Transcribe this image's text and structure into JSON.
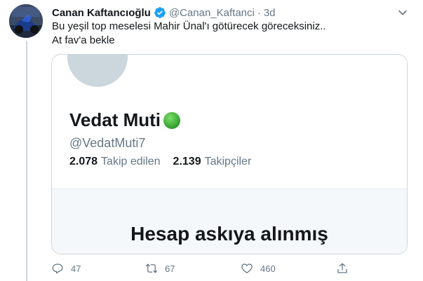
{
  "tweet": {
    "author_name": "Canan Kaftancıoğlu",
    "author_handle": "@Canan_Kaftanci",
    "separator": "·",
    "time": "3d",
    "text_line1": "Bu yeşil top meselesi Mahir Ünal'ı götürecek göreceksiniz..",
    "text_line2": "At fav'a bekle"
  },
  "card": {
    "name": "Vedat Muti",
    "handle": "@VedatMuti7",
    "following_count": "2.078",
    "following_label": "Takip edilen",
    "followers_count": "2.139",
    "followers_label": "Takipçiler",
    "suspended_text": "Hesap askıya alınmış"
  },
  "actions": {
    "replies": "47",
    "retweets": "67",
    "likes": "460"
  },
  "icons": {
    "verified": "verified-badge-icon",
    "caret": "chevron-down-icon",
    "reply": "reply-icon",
    "retweet": "retweet-icon",
    "like": "heart-icon",
    "share": "share-icon",
    "status": "green-circle-emoji"
  },
  "colors": {
    "verified_blue": "#1da1f2",
    "secondary_text": "#657786",
    "green_dot": "#3cb043"
  }
}
